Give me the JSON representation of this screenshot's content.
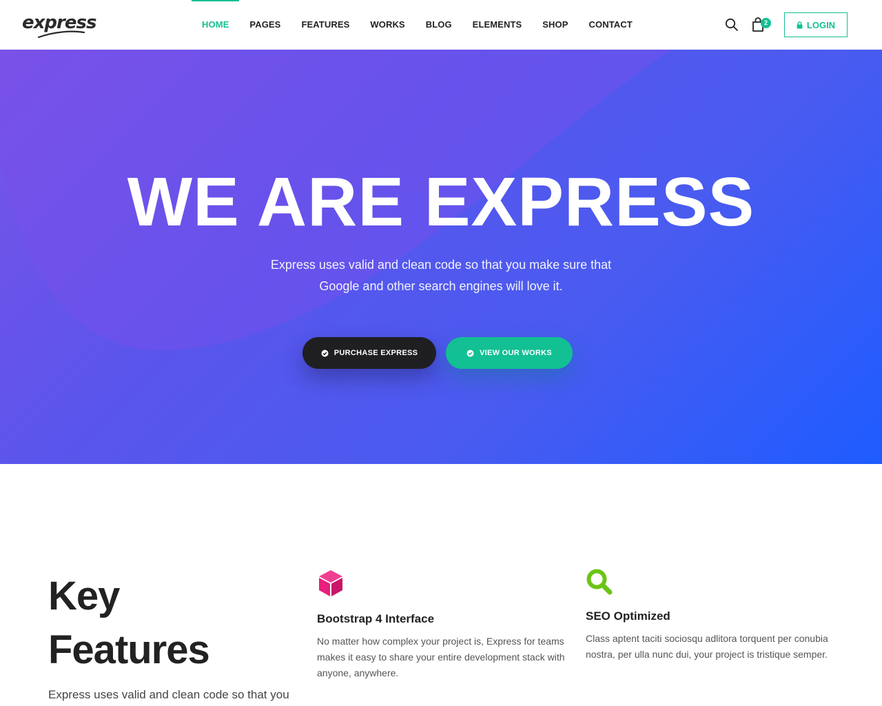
{
  "brand": {
    "logo_text": "express"
  },
  "nav": {
    "items": [
      {
        "label": "HOME",
        "active": true
      },
      {
        "label": "PAGES"
      },
      {
        "label": "FEATURES"
      },
      {
        "label": "WORKS"
      },
      {
        "label": "BLOG"
      },
      {
        "label": "ELEMENTS"
      },
      {
        "label": "SHOP"
      },
      {
        "label": "CONTACT"
      }
    ]
  },
  "header_actions": {
    "search_icon": "search-icon",
    "cart_icon": "shopping-bag-icon",
    "cart_count": "2",
    "login_label": "LOGIN",
    "login_icon": "lock-icon"
  },
  "hero": {
    "title": "WE ARE EXPRESS",
    "subtitle_line1": "Express uses valid and clean code so that you make sure that",
    "subtitle_line2": "Google and other search engines will love it.",
    "primary_button": "PURCHASE EXPRESS",
    "secondary_button": "VIEW OUR WORKS",
    "button_icon": "check-circle-icon"
  },
  "features": {
    "title_line1": "Key",
    "title_line2": "Features",
    "description": "Express uses valid and clean code so that you",
    "items": [
      {
        "icon": "cube-icon",
        "title": "Bootstrap 4 Interface",
        "text": "No matter how complex your project is, Express for teams makes it easy to share your entire development stack with anyone, anywhere."
      },
      {
        "icon": "magnifier-icon",
        "title": "SEO Optimized",
        "text": "Class aptent taciti sociosqu adlitora torquent per conubia nostra, per ulla nunc dui, your project is tristique semper."
      }
    ]
  },
  "colors": {
    "accent": "#12c093",
    "dark_button": "#1f1f22",
    "cube_icon": "#e91e7d",
    "seo_icon": "#6cc417",
    "hero_gradient_start": "#7b53e6",
    "hero_gradient_end": "#1e5cff"
  }
}
